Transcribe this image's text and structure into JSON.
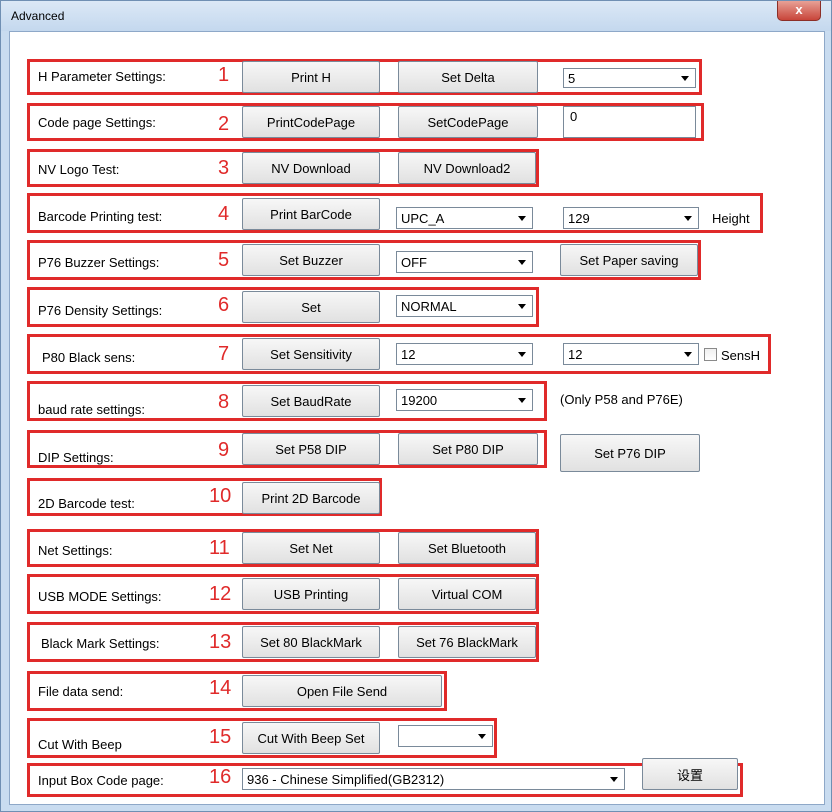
{
  "window": {
    "title": "Advanced",
    "close": "x"
  },
  "rows": {
    "r1": {
      "label": "H Parameter Settings:",
      "num": "1",
      "btn1": "Print H",
      "btn2": "Set Delta",
      "combo": "5"
    },
    "r2": {
      "label": "Code page Settings:",
      "num": "2",
      "btn1": "PrintCodePage",
      "btn2": "SetCodePage",
      "text": "0"
    },
    "r3": {
      "label": "NV Logo Test:",
      "num": "3",
      "btn1": "NV Download",
      "btn2": "NV Download2"
    },
    "r4": {
      "label": "Barcode Printing test:",
      "num": "4",
      "btn1": "Print BarCode",
      "combo1": "UPC_A",
      "combo2": "129",
      "suffix": "Height"
    },
    "r5": {
      "label": "P76 Buzzer Settings:",
      "num": "5",
      "btn1": "Set Buzzer",
      "combo": "OFF",
      "btn2": "Set Paper saving"
    },
    "r6": {
      "label": "P76 Density Settings:",
      "num": "6",
      "btn1": "Set",
      "combo": "NORMAL"
    },
    "r7": {
      "label": "P80 Black sens:",
      "num": "7",
      "btn1": "Set Sensitivity",
      "combo1": "12",
      "combo2": "12",
      "check": "SensH"
    },
    "r8": {
      "label": "baud rate settings:",
      "num": "8",
      "btn1": "Set BaudRate",
      "combo": "19200",
      "note": "(Only P58 and P76E)"
    },
    "r9": {
      "label": "DIP Settings:",
      "num": "9",
      "btn1": "Set P58 DIP",
      "btn2": "Set P80 DIP",
      "btn3": "Set P76 DIP"
    },
    "r10": {
      "label": "2D Barcode test:",
      "num": "10",
      "btn1": "Print 2D Barcode"
    },
    "r11": {
      "label": "Net Settings:",
      "num": "11",
      "btn1": "Set Net",
      "btn2": "Set Bluetooth"
    },
    "r12": {
      "label": "USB MODE Settings:",
      "num": "12",
      "btn1": "USB Printing",
      "btn2": "Virtual COM"
    },
    "r13": {
      "label": "Black Mark Settings:",
      "num": "13",
      "btn1": "Set 80 BlackMark",
      "btn2": "Set 76 BlackMark"
    },
    "r14": {
      "label": "File data send:",
      "num": "14",
      "btn1": "Open File Send"
    },
    "r15": {
      "label": "Cut With Beep",
      "num": "15",
      "btn1": "Cut With Beep Set",
      "combo": ""
    },
    "r16": {
      "label": "Input Box Code page:",
      "num": "16",
      "combo": "936 - Chinese Simplified(GB2312)",
      "btn1": "设置"
    }
  }
}
